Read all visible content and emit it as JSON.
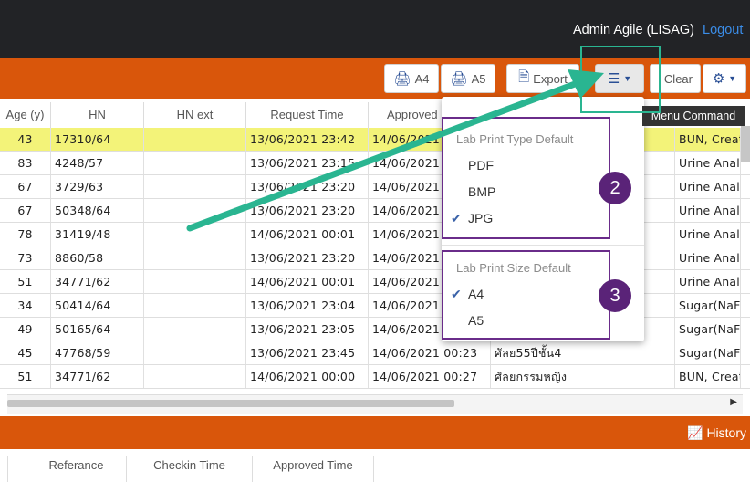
{
  "header": {
    "user": "Admin Agile (LISAG)",
    "logout": "Logout"
  },
  "toolbar": {
    "a4": "A4",
    "a5": "A5",
    "export": "Export",
    "clear": "Clear"
  },
  "columns": [
    "Age (y)",
    "HN",
    "HN ext",
    "Request Time",
    "Approved"
  ],
  "rows": [
    {
      "age": "43",
      "hn": "17310/64",
      "hn_ext": "",
      "req": "13/06/2021  23:42",
      "appr": "14/06/2021",
      "name": "",
      "test": "BUN, Creat"
    },
    {
      "age": "83",
      "hn": "4248/57",
      "hn_ext": "",
      "req": "13/06/2021  23:15",
      "appr": "14/06/2021",
      "name": "",
      "test": "Urine Analy"
    },
    {
      "age": "67",
      "hn": "3729/63",
      "hn_ext": "",
      "req": "13/06/2021  23:20",
      "appr": "14/06/2021",
      "name": "",
      "test": "Urine Analy"
    },
    {
      "age": "67",
      "hn": "50348/64",
      "hn_ext": "",
      "req": "13/06/2021  23:20",
      "appr": "14/06/2021",
      "name": "",
      "test": "Urine Analy"
    },
    {
      "age": "78",
      "hn": "31419/48",
      "hn_ext": "",
      "req": "14/06/2021  00:01",
      "appr": "14/06/2021",
      "name": "",
      "test": "Urine Analy"
    },
    {
      "age": "73",
      "hn": "8860/58",
      "hn_ext": "",
      "req": "13/06/2021  23:20",
      "appr": "14/06/2021",
      "name": "",
      "test": "Urine Analy"
    },
    {
      "age": "51",
      "hn": "34771/62",
      "hn_ext": "",
      "req": "14/06/2021  00:01",
      "appr": "14/06/2021",
      "name": "",
      "test": "Urine Analy"
    },
    {
      "age": "34",
      "hn": "50414/64",
      "hn_ext": "",
      "req": "13/06/2021  23:04",
      "appr": "14/06/2021",
      "name": "",
      "test": "Sugar(NaF)"
    },
    {
      "age": "49",
      "hn": "50165/64",
      "hn_ext": "",
      "req": "13/06/2021  23:05",
      "appr": "14/06/2021",
      "name": "",
      "test": "Sugar(NaF)"
    },
    {
      "age": "45",
      "hn": "47768/59",
      "hn_ext": "",
      "req": "13/06/2021  23:45",
      "appr": "14/06/2021  00:23",
      "name": "ศัลย55ปีชั้น4",
      "test": "Sugar(NaF)"
    },
    {
      "age": "51",
      "hn": "34771/62",
      "hn_ext": "",
      "req": "14/06/2021  00:00",
      "appr": "14/06/2021  00:27",
      "name": "ศัลยกรรมหญิง",
      "test": "BUN, Creat"
    }
  ],
  "dropdown": {
    "type_header": "Lab Print Type Default",
    "type_options": [
      "PDF",
      "BMP",
      "JPG"
    ],
    "type_selected": "JPG",
    "size_header": "Lab Print Size Default",
    "size_options": [
      "A4",
      "A5"
    ],
    "size_selected": "A4",
    "badge_type": "2",
    "badge_size": "3"
  },
  "tooltip": "Menu Command",
  "history": "History",
  "bottom_columns": [
    "Referance",
    "Checkin Time",
    "Approved Time"
  ],
  "colors": {
    "accent": "#d9560b",
    "highlight": "#f3f379",
    "annotation": "#2ab591",
    "badge": "#5a2378"
  }
}
